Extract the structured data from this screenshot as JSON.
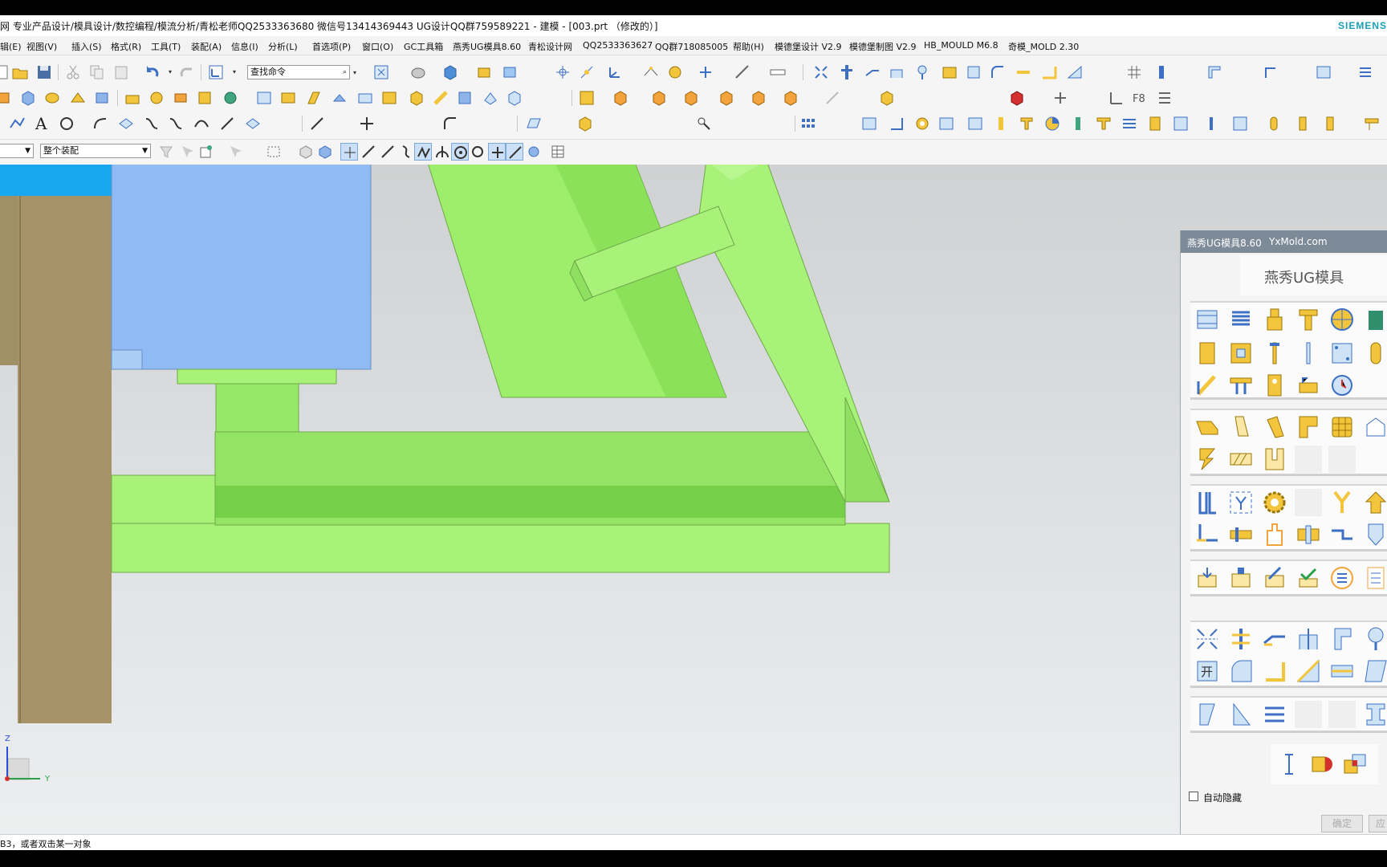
{
  "window": {
    "title": "网 专业产品设计/模具设计/数控编程/模流分析/青松老师QQ2533363680 微信号13414369443 UG设计QQ群759589221 - 建模 - [003.prt （修改的）]",
    "brand": "SIEMENS"
  },
  "menu": [
    "辑(E)",
    "视图(V)",
    "插入(S)",
    "格式(R)",
    "工具(T)",
    "装配(A)",
    "信息(I)",
    "分析(L)",
    "首选项(P)",
    "窗口(O)",
    "GC工具箱",
    "燕秀UG模具8.60",
    "青松设计网",
    "QQ2533363627",
    "QQ群718085005",
    "帮助(H)",
    "模德堡设计 V2.9",
    "模德堡制图 V2.9",
    "HB_MOULD M6.8",
    "奇模_MOLD 2.30"
  ],
  "toolbar": {
    "search_placeholder": "查找命令",
    "filter_left_value": "",
    "assembly_scope_value": "整个装配"
  },
  "status": {
    "prompt": "B3，或者双击某一对象"
  },
  "axes": {
    "z_label": "Z",
    "y_label": "Y"
  },
  "dialog": {
    "title": "燕秀UG模具8.60",
    "site": "YxMold.com",
    "banner": "燕秀UG模具",
    "open_glyph": "开",
    "autohide_label": "自动隐藏",
    "autohide_checked": false,
    "ok_label": "确定",
    "apply_label": "应"
  },
  "colors": {
    "part_green": "#a8f27a",
    "part_green_dark": "#6fd13e",
    "plate_blue": "#8fbaf3",
    "header_blue": "#17a8f0",
    "column_olive": "#a69468",
    "icon_yellow": "#f2c53c",
    "icon_blue": "#3d8fd6"
  }
}
